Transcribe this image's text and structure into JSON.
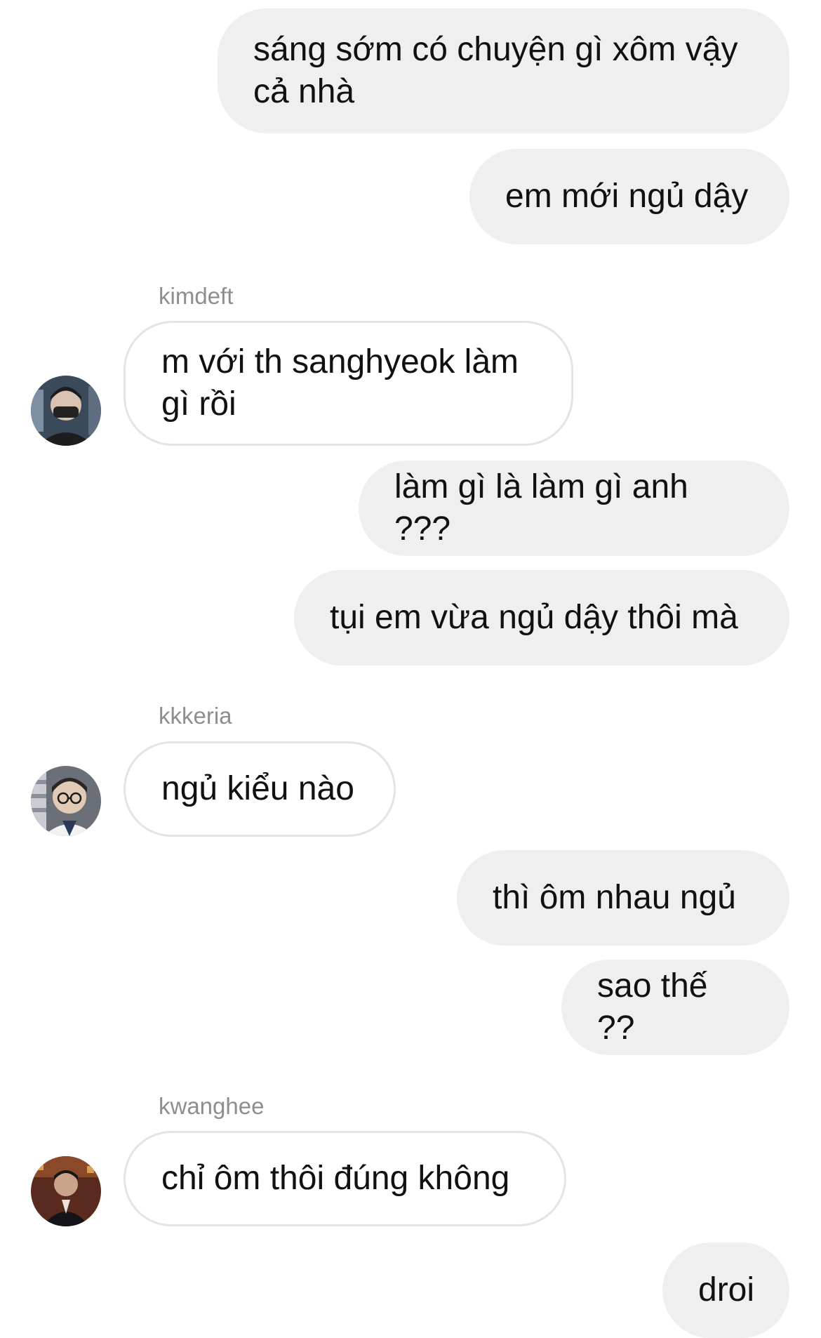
{
  "conversation": {
    "messages": [
      {
        "id": "m1",
        "direction": "outgoing",
        "text": "sáng sớm có chuyện gì xôm vậy cả nhà"
      },
      {
        "id": "m2",
        "direction": "outgoing",
        "text": "em mới ngủ dậy"
      },
      {
        "id": "m3",
        "direction": "incoming",
        "sender": "kimdeft",
        "text": "m với th sanghyeok làm gì rồi"
      },
      {
        "id": "m4",
        "direction": "outgoing",
        "text": "làm gì là làm gì anh ???"
      },
      {
        "id": "m5",
        "direction": "outgoing",
        "text": "tụi em vừa ngủ dậy thôi mà"
      },
      {
        "id": "m6",
        "direction": "incoming",
        "sender": "kkkeria",
        "text": "ngủ kiểu nào"
      },
      {
        "id": "m7",
        "direction": "outgoing",
        "text": "thì ôm nhau ngủ"
      },
      {
        "id": "m8",
        "direction": "outgoing",
        "text": "sao thế ??"
      },
      {
        "id": "m9",
        "direction": "incoming",
        "sender": "kwanghee",
        "text": "chỉ ôm thôi đúng không"
      },
      {
        "id": "m10",
        "direction": "outgoing",
        "text": "droi"
      }
    ]
  },
  "avatars": {
    "kimdeft": {
      "icon": "avatar-masked-photo",
      "bg": "#3a4a5a"
    },
    "kkkeria": {
      "icon": "avatar-glasses-photo",
      "bg": "#6b6f78"
    },
    "kwanghee": {
      "icon": "avatar-suit-photo",
      "bg": "#5a2a1e"
    }
  },
  "colors": {
    "outgoing_bubble": "#efefef",
    "incoming_border": "#e4e4e4",
    "sender_label": "#8e8e8e",
    "text": "#111111"
  }
}
